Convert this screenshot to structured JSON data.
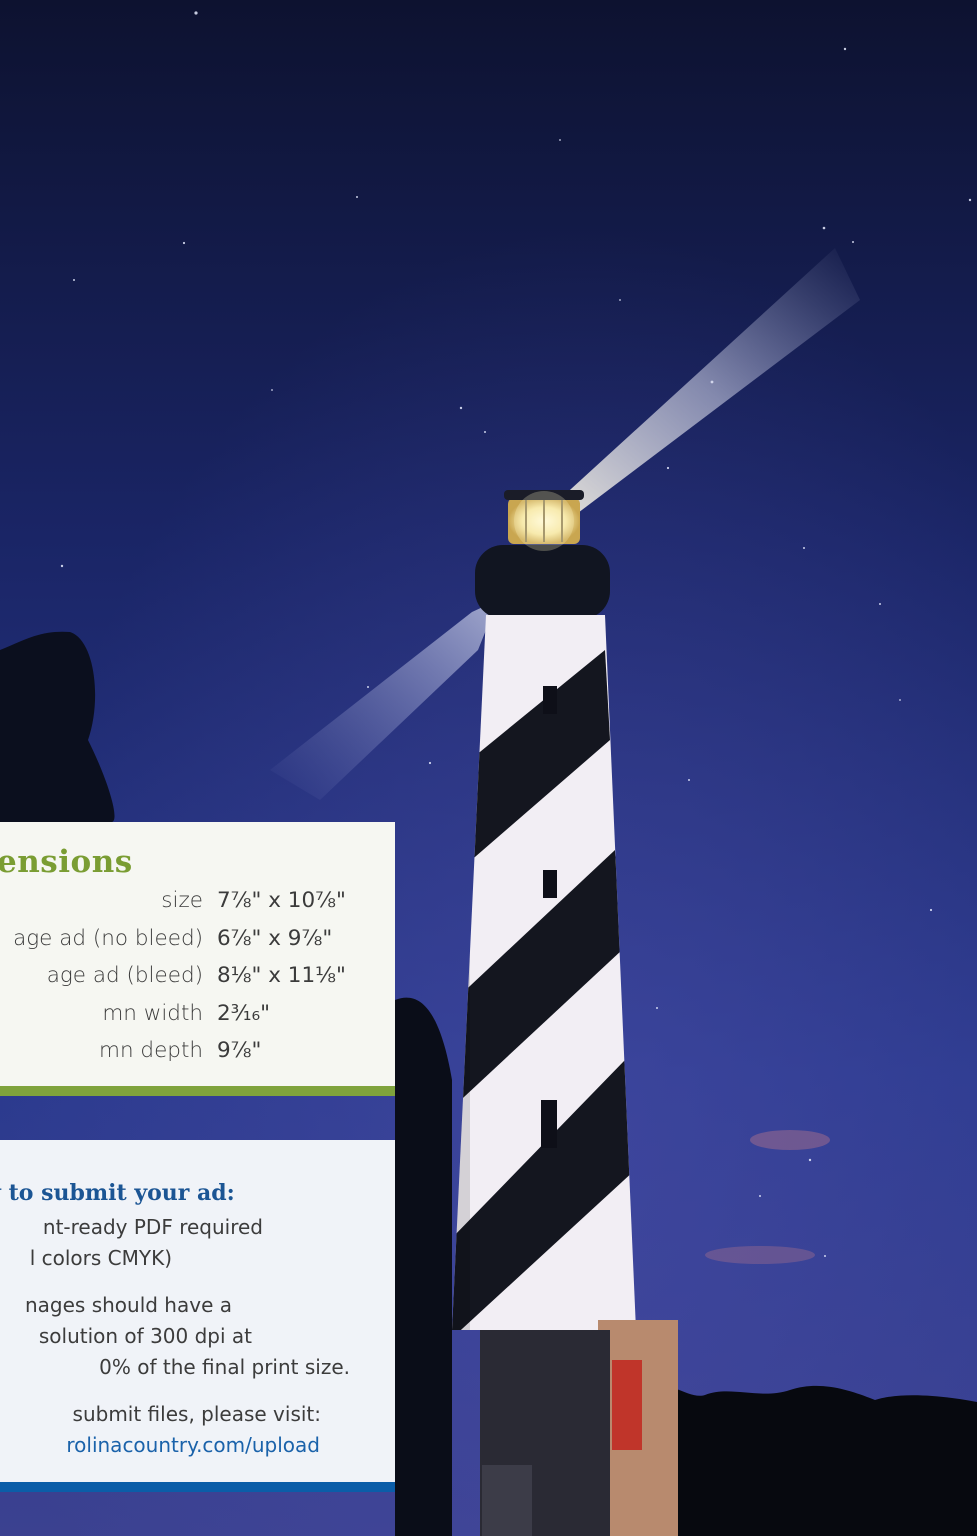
{
  "dimensions": {
    "heading": "nensions",
    "rows": [
      {
        "label": "size",
        "value": "7⅞\" x 10⅞\""
      },
      {
        "label": "age ad (no bleed)",
        "value": "6⅞\" x 9⅞\""
      },
      {
        "label": "age ad (bleed)",
        "value": "8⅛\" x 11⅛\""
      },
      {
        "label": "mn width",
        "value": "2³⁄₁₆\""
      },
      {
        "label": "mn depth",
        "value": "9⅞\""
      }
    ]
  },
  "submit": {
    "heading": "w to submit your ad:",
    "items": [
      {
        "lines": [
          "nt-ready PDF required",
          "l colors CMYK)"
        ]
      },
      {
        "lines": [
          "nages should have a",
          "solution of 300 dpi at",
          "0% of the final print size."
        ]
      },
      {
        "lines": [
          "submit files, please visit:",
          "rolinacountry.com/upload"
        ]
      }
    ]
  },
  "colors": {
    "sky_top": "#0d1230",
    "sky_mid": "#1d2d78",
    "sky_low": "#3a4596",
    "dimensions_accent": "#7fa33c",
    "submit_accent": "#0b5da8",
    "link": "#1a62aa"
  }
}
